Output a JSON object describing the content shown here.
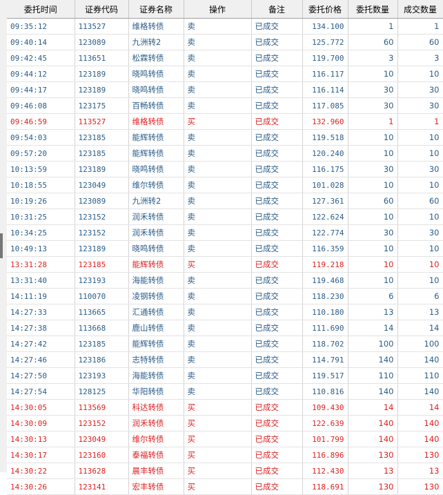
{
  "columns": [
    "委托时间",
    "证券代码",
    "证券名称",
    "操作",
    "备注",
    "委托价格",
    "委托数量",
    "成交数量"
  ],
  "rows": [
    {
      "time": "09:35:12",
      "code": "113527",
      "name": "维格转债",
      "op": "卖",
      "note": "已成交",
      "price": "134.100",
      "qty": "1",
      "filled": "1",
      "side": "sell"
    },
    {
      "time": "09:40:14",
      "code": "123089",
      "name": "九洲转2",
      "op": "卖",
      "note": "已成交",
      "price": "125.772",
      "qty": "60",
      "filled": "60",
      "side": "sell"
    },
    {
      "time": "09:42:45",
      "code": "113651",
      "name": "松霖转债",
      "op": "卖",
      "note": "已成交",
      "price": "119.700",
      "qty": "3",
      "filled": "3",
      "side": "sell"
    },
    {
      "time": "09:44:12",
      "code": "123189",
      "name": "晓鸣转债",
      "op": "卖",
      "note": "已成交",
      "price": "116.117",
      "qty": "10",
      "filled": "10",
      "side": "sell"
    },
    {
      "time": "09:44:17",
      "code": "123189",
      "name": "晓鸣转债",
      "op": "卖",
      "note": "已成交",
      "price": "116.114",
      "qty": "30",
      "filled": "30",
      "side": "sell"
    },
    {
      "time": "09:46:08",
      "code": "123175",
      "name": "百畅转债",
      "op": "卖",
      "note": "已成交",
      "price": "117.085",
      "qty": "30",
      "filled": "30",
      "side": "sell"
    },
    {
      "time": "09:46:59",
      "code": "113527",
      "name": "维格转债",
      "op": "买",
      "note": "已成交",
      "price": "132.960",
      "qty": "1",
      "filled": "1",
      "side": "buy"
    },
    {
      "time": "09:54:03",
      "code": "123185",
      "name": "能辉转债",
      "op": "卖",
      "note": "已成交",
      "price": "119.518",
      "qty": "10",
      "filled": "10",
      "side": "sell"
    },
    {
      "time": "09:57:20",
      "code": "123185",
      "name": "能辉转债",
      "op": "卖",
      "note": "已成交",
      "price": "120.240",
      "qty": "10",
      "filled": "10",
      "side": "sell"
    },
    {
      "time": "10:13:59",
      "code": "123189",
      "name": "晓鸣转债",
      "op": "卖",
      "note": "已成交",
      "price": "116.175",
      "qty": "30",
      "filled": "30",
      "side": "sell"
    },
    {
      "time": "10:18:55",
      "code": "123049",
      "name": "维尔转债",
      "op": "卖",
      "note": "已成交",
      "price": "101.028",
      "qty": "10",
      "filled": "10",
      "side": "sell"
    },
    {
      "time": "10:19:26",
      "code": "123089",
      "name": "九洲转2",
      "op": "卖",
      "note": "已成交",
      "price": "127.361",
      "qty": "60",
      "filled": "60",
      "side": "sell"
    },
    {
      "time": "10:31:25",
      "code": "123152",
      "name": "润禾转债",
      "op": "卖",
      "note": "已成交",
      "price": "122.624",
      "qty": "10",
      "filled": "10",
      "side": "sell"
    },
    {
      "time": "10:34:25",
      "code": "123152",
      "name": "润禾转债",
      "op": "卖",
      "note": "已成交",
      "price": "122.774",
      "qty": "30",
      "filled": "30",
      "side": "sell"
    },
    {
      "time": "10:49:13",
      "code": "123189",
      "name": "晓鸣转债",
      "op": "卖",
      "note": "已成交",
      "price": "116.359",
      "qty": "10",
      "filled": "10",
      "side": "sell"
    },
    {
      "time": "13:31:28",
      "code": "123185",
      "name": "能辉转债",
      "op": "买",
      "note": "已成交",
      "price": "119.218",
      "qty": "10",
      "filled": "10",
      "side": "buy"
    },
    {
      "time": "13:31:40",
      "code": "123193",
      "name": "海能转债",
      "op": "卖",
      "note": "已成交",
      "price": "119.468",
      "qty": "10",
      "filled": "10",
      "side": "sell"
    },
    {
      "time": "14:11:19",
      "code": "110070",
      "name": "凌钢转债",
      "op": "卖",
      "note": "已成交",
      "price": "118.230",
      "qty": "6",
      "filled": "6",
      "side": "sell"
    },
    {
      "time": "14:27:33",
      "code": "113665",
      "name": "汇通转债",
      "op": "卖",
      "note": "已成交",
      "price": "110.180",
      "qty": "13",
      "filled": "13",
      "side": "sell"
    },
    {
      "time": "14:27:38",
      "code": "113668",
      "name": "鹿山转债",
      "op": "卖",
      "note": "已成交",
      "price": "111.690",
      "qty": "14",
      "filled": "14",
      "side": "sell"
    },
    {
      "time": "14:27:42",
      "code": "123185",
      "name": "能辉转债",
      "op": "卖",
      "note": "已成交",
      "price": "118.702",
      "qty": "100",
      "filled": "100",
      "side": "sell"
    },
    {
      "time": "14:27:46",
      "code": "123186",
      "name": "志特转债",
      "op": "卖",
      "note": "已成交",
      "price": "114.791",
      "qty": "140",
      "filled": "140",
      "side": "sell"
    },
    {
      "time": "14:27:50",
      "code": "123193",
      "name": "海能转债",
      "op": "卖",
      "note": "已成交",
      "price": "119.517",
      "qty": "110",
      "filled": "110",
      "side": "sell"
    },
    {
      "time": "14:27:54",
      "code": "128125",
      "name": "华阳转债",
      "op": "卖",
      "note": "已成交",
      "price": "110.816",
      "qty": "140",
      "filled": "140",
      "side": "sell"
    },
    {
      "time": "14:30:05",
      "code": "113569",
      "name": "科达转债",
      "op": "买",
      "note": "已成交",
      "price": "109.430",
      "qty": "14",
      "filled": "14",
      "side": "buy"
    },
    {
      "time": "14:30:09",
      "code": "123152",
      "name": "润禾转债",
      "op": "买",
      "note": "已成交",
      "price": "122.639",
      "qty": "140",
      "filled": "140",
      "side": "buy"
    },
    {
      "time": "14:30:13",
      "code": "123049",
      "name": "维尔转债",
      "op": "买",
      "note": "已成交",
      "price": "101.799",
      "qty": "140",
      "filled": "140",
      "side": "buy"
    },
    {
      "time": "14:30:17",
      "code": "123160",
      "name": "泰福转债",
      "op": "买",
      "note": "已成交",
      "price": "116.896",
      "qty": "130",
      "filled": "130",
      "side": "buy"
    },
    {
      "time": "14:30:22",
      "code": "113628",
      "name": "晨丰转债",
      "op": "买",
      "note": "已成交",
      "price": "112.430",
      "qty": "13",
      "filled": "13",
      "side": "buy"
    },
    {
      "time": "14:30:26",
      "code": "123141",
      "name": "宏丰转债",
      "op": "买",
      "note": "已成交",
      "price": "118.691",
      "qty": "130",
      "filled": "130",
      "side": "buy"
    }
  ],
  "colors": {
    "sell": "#2a5c8a",
    "buy": "#e02020",
    "header_bg": "#f0f0f0"
  }
}
